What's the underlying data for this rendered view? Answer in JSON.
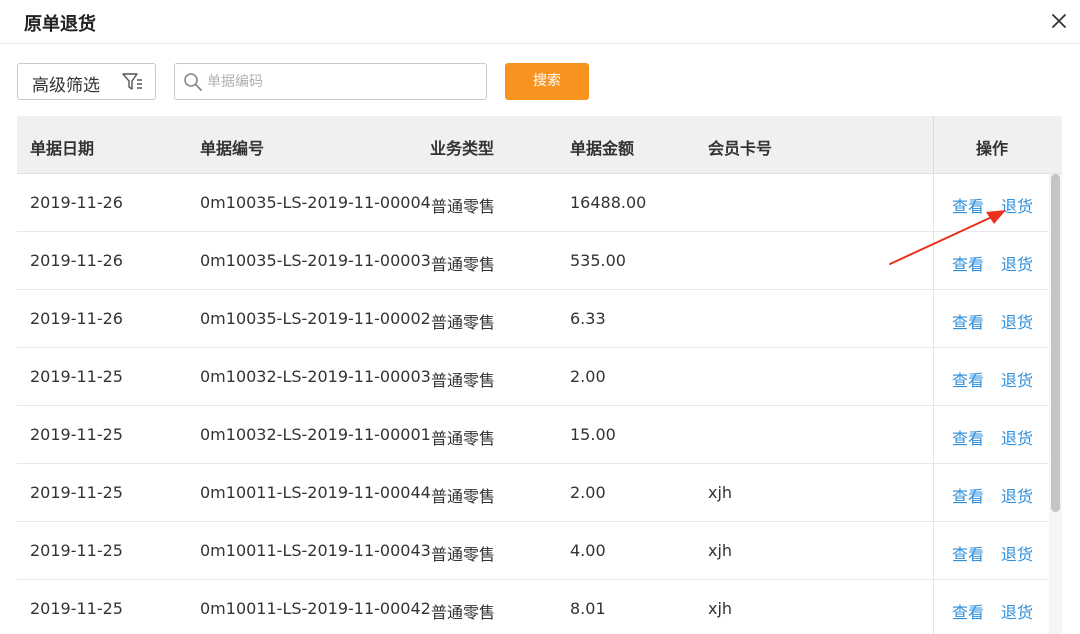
{
  "dialog": {
    "title": "原单退货"
  },
  "toolbar": {
    "filter_label": "高级筛选",
    "search_placeholder": "单据编码",
    "search_value": "",
    "search_button": "搜索"
  },
  "table": {
    "headers": {
      "date": "单据日期",
      "number": "单据编号",
      "type": "业务类型",
      "amount": "单据金额",
      "member": "会员卡号",
      "actions": "操作"
    },
    "view_label": "查看",
    "return_label": "退货",
    "rows": [
      {
        "date": "2019-11-26",
        "number": "0m10035-LS-2019-11-00004",
        "type": "普通零售",
        "amount": "16488.00",
        "member": ""
      },
      {
        "date": "2019-11-26",
        "number": "0m10035-LS-2019-11-00003",
        "type": "普通零售",
        "amount": "535.00",
        "member": ""
      },
      {
        "date": "2019-11-26",
        "number": "0m10035-LS-2019-11-00002",
        "type": "普通零售",
        "amount": "6.33",
        "member": ""
      },
      {
        "date": "2019-11-25",
        "number": "0m10032-LS-2019-11-00003",
        "type": "普通零售",
        "amount": "2.00",
        "member": ""
      },
      {
        "date": "2019-11-25",
        "number": "0m10032-LS-2019-11-00001",
        "type": "普通零售",
        "amount": "15.00",
        "member": ""
      },
      {
        "date": "2019-11-25",
        "number": "0m10011-LS-2019-11-00044",
        "type": "普通零售",
        "amount": "2.00",
        "member": "xjh"
      },
      {
        "date": "2019-11-25",
        "number": "0m10011-LS-2019-11-00043",
        "type": "普通零售",
        "amount": "4.00",
        "member": "xjh"
      },
      {
        "date": "2019-11-25",
        "number": "0m10011-LS-2019-11-00042",
        "type": "普通零售",
        "amount": "8.01",
        "member": "xjh"
      }
    ]
  },
  "colors": {
    "accent": "#f7931e",
    "link": "#2f8fdb",
    "annotation": "#e8321e"
  },
  "icons": {
    "close": "close-icon",
    "filter": "filter-icon",
    "search": "search-icon"
  }
}
